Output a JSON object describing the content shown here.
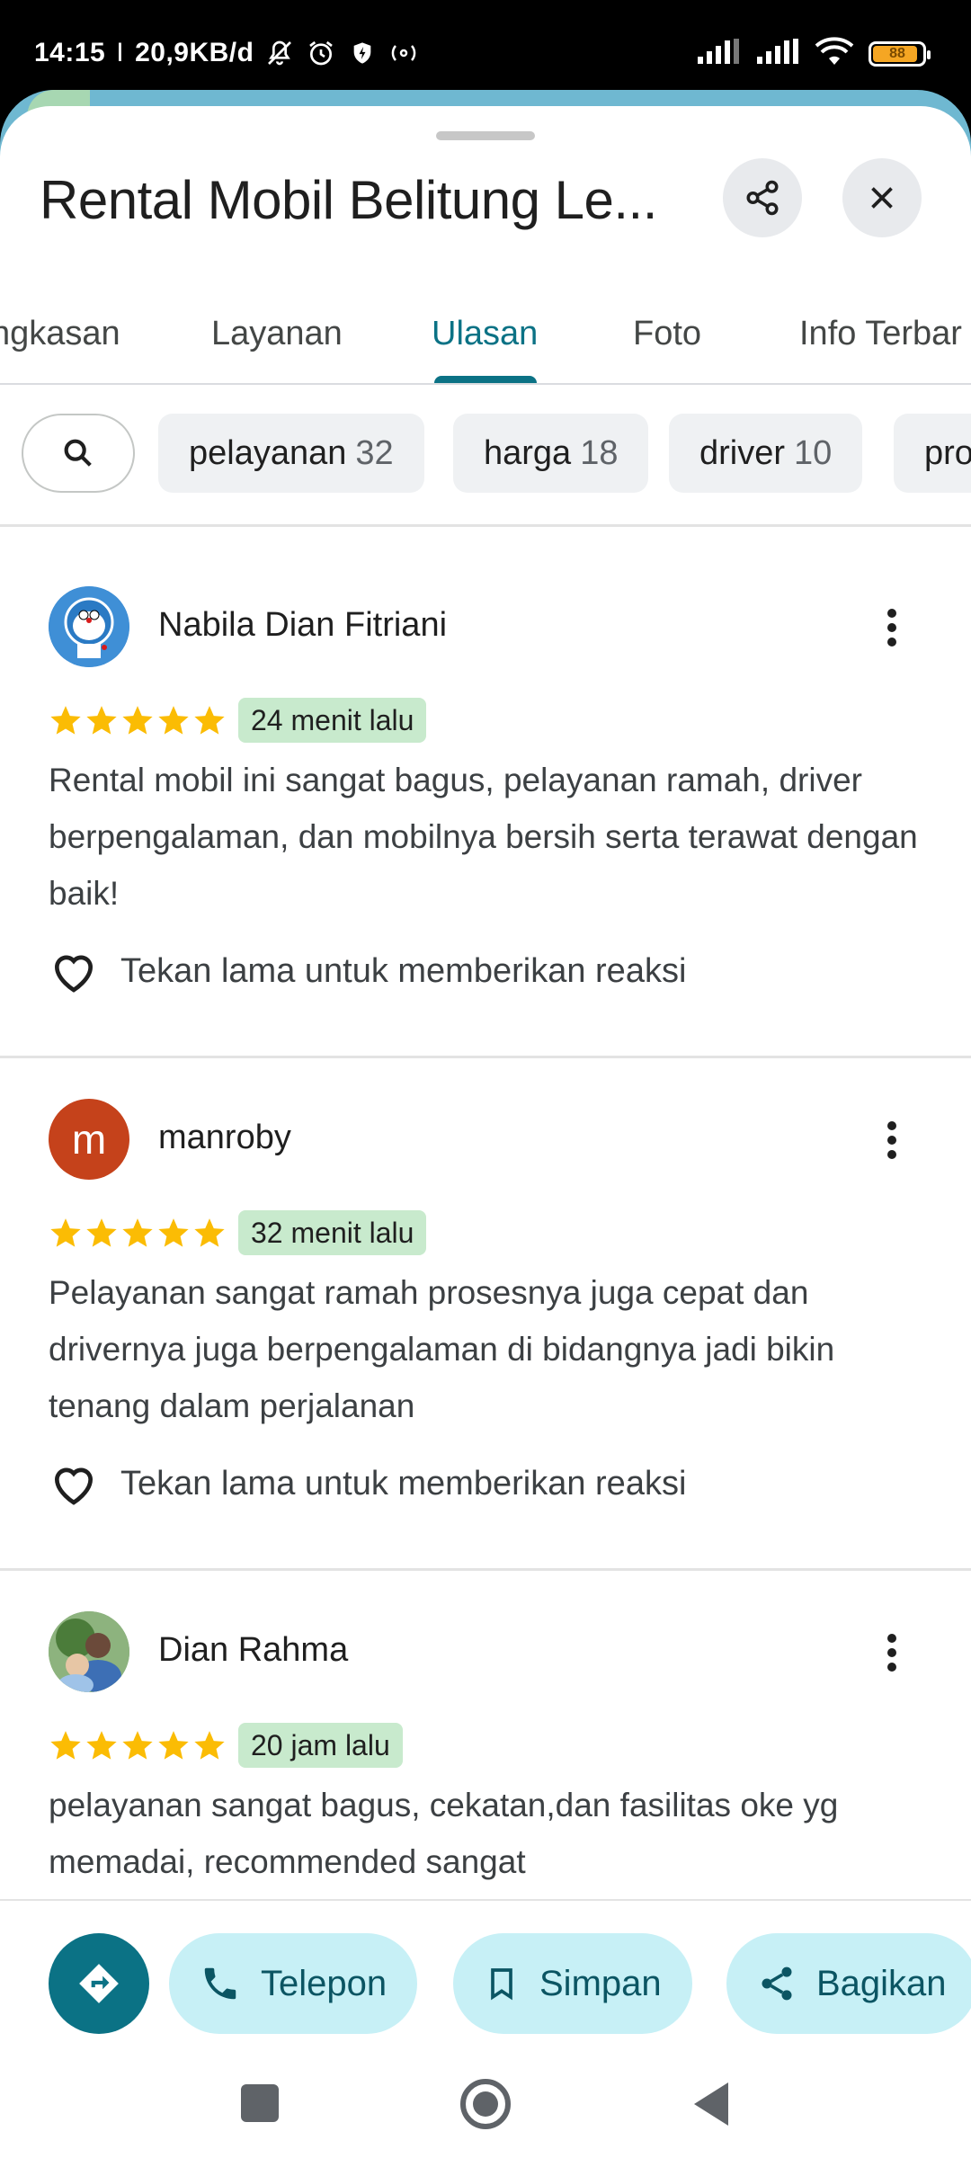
{
  "status_bar": {
    "time": "14:15",
    "network_speed": "20,9KB/d",
    "battery_level": "88",
    "icons": [
      "bell-off-icon",
      "alarm-icon",
      "shield-icon",
      "nfc-icon",
      "signal-icon",
      "signal-icon",
      "wifi-icon",
      "battery-icon"
    ]
  },
  "header": {
    "title": "Rental Mobil Belitung Le...",
    "share_icon": "share-icon",
    "close_icon": "close-icon"
  },
  "tabs": [
    "ngkasan",
    "Layanan",
    "Ulasan",
    "Foto",
    "Info Terbar"
  ],
  "active_tab": "Ulasan",
  "filters": {
    "search_icon": "search-icon",
    "chips": [
      {
        "label": "pelayanan",
        "count": "32"
      },
      {
        "label": "harga",
        "count": "18"
      },
      {
        "label": "driver",
        "count": "10"
      },
      {
        "label": "pro",
        "count": ""
      }
    ]
  },
  "reviews": [
    {
      "name": "Nabila Dian Fitriani",
      "avatar": "doraemon-avatar",
      "rating": 5,
      "time": "24 menit lalu",
      "text": "Rental mobil ini sangat bagus, pelayanan ramah, driver berpengalaman, dan mobilnya bersih serta terawat dengan baik!",
      "reaction": "Tekan lama untuk memberikan reaksi"
    },
    {
      "name": "manroby",
      "avatar_letter": "m",
      "avatar_color": "#c5421b",
      "rating": 5,
      "time": "32 menit lalu",
      "text": "Pelayanan sangat ramah prosesnya juga cepat dan drivernya juga berpengalaman di bidangnya jadi bikin tenang dalam perjalanan",
      "reaction": "Tekan lama untuk memberikan reaksi"
    },
    {
      "name": "Dian Rahma",
      "avatar": "photo-avatar",
      "rating": 5,
      "time": "20 jam lalu",
      "text": "pelayanan sangat bagus, cekatan,dan fasilitas oke yg memadai, recommended sangat"
    }
  ],
  "actions": {
    "directions_icon": "directions-icon",
    "call": "Telepon",
    "save": "Simpan",
    "share": "Bagikan"
  },
  "colors": {
    "accent": "#0b7285",
    "chip_bg": "#eff1f3",
    "action_bg": "#c7f0f6",
    "star": "#fbbc04",
    "badge_bg": "#c8eacd"
  }
}
